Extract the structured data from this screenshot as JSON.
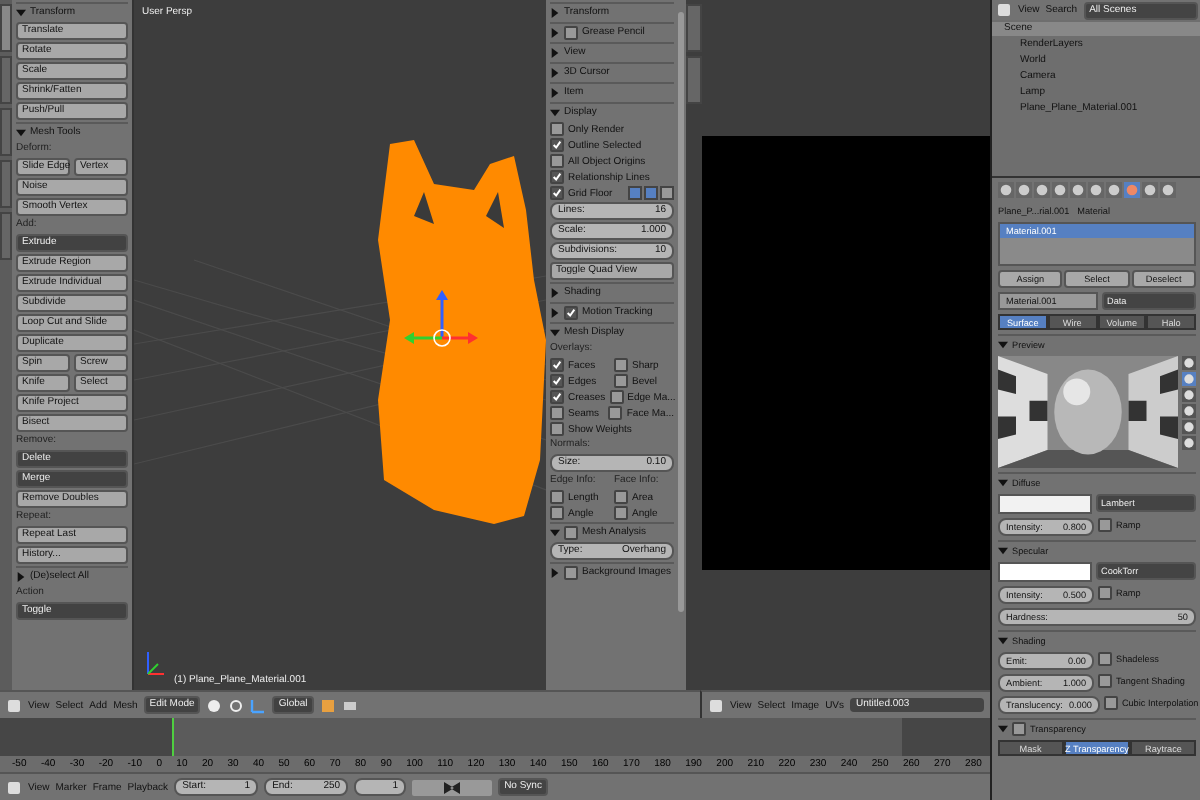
{
  "toolbar": {
    "tabs": [
      {
        "selected": true
      },
      {
        "selected": false
      },
      {
        "selected": false
      },
      {
        "selected": false
      },
      {
        "selected": false
      }
    ],
    "rows": [
      {
        "kind": "header",
        "text": "Transform",
        "expanded": true
      },
      {
        "kind": "button",
        "text": "Translate"
      },
      {
        "kind": "button",
        "text": "Rotate"
      },
      {
        "kind": "button",
        "text": "Scale"
      },
      {
        "kind": "button",
        "text": "Shrink/Fatten"
      },
      {
        "kind": "button",
        "text": "Push/Pull"
      },
      {
        "kind": "header",
        "text": "Mesh Tools",
        "expanded": true
      },
      {
        "kind": "label",
        "text": "Deform:"
      },
      {
        "kind": "pair",
        "texts": [
          "Slide Edge",
          "Vertex"
        ]
      },
      {
        "kind": "button",
        "text": "Noise"
      },
      {
        "kind": "button",
        "text": "Smooth Vertex"
      },
      {
        "kind": "label",
        "text": "Add:"
      },
      {
        "kind": "dropdown",
        "text": "Extrude"
      },
      {
        "kind": "button",
        "text": "Extrude Region"
      },
      {
        "kind": "button",
        "text": "Extrude Individual"
      },
      {
        "kind": "button",
        "text": "Subdivide"
      },
      {
        "kind": "button",
        "text": "Loop Cut and Slide"
      },
      {
        "kind": "button",
        "text": "Duplicate"
      },
      {
        "kind": "pair",
        "texts": [
          "Spin",
          "Screw"
        ]
      },
      {
        "kind": "pair",
        "texts": [
          "Knife",
          "Select"
        ]
      },
      {
        "kind": "button",
        "text": "Knife Project"
      },
      {
        "kind": "button",
        "text": "Bisect"
      },
      {
        "kind": "label",
        "text": "Remove:"
      },
      {
        "kind": "dropdown",
        "text": "Delete"
      },
      {
        "kind": "dropdown",
        "text": "Merge"
      },
      {
        "kind": "button",
        "text": "Remove Doubles"
      },
      {
        "kind": "label",
        "text": "Repeat:"
      },
      {
        "kind": "button",
        "text": "Repeat Last"
      },
      {
        "kind": "button",
        "text": "History..."
      },
      {
        "kind": "header",
        "text": "(De)select All",
        "expanded": false
      },
      {
        "kind": "label",
        "text": "Action"
      },
      {
        "kind": "dropdown",
        "text": "Toggle"
      }
    ]
  },
  "viewport": {
    "title": "User Persp",
    "object_label": "(1) Plane_Plane_Material.001"
  },
  "npanel": {
    "rows": [
      {
        "kind": "header",
        "text": "Transform",
        "expanded": false
      },
      {
        "kind": "header",
        "text": "Grease Pencil",
        "expanded": false,
        "checked": false
      },
      {
        "kind": "header",
        "text": "View",
        "expanded": false
      },
      {
        "kind": "header",
        "text": "3D Cursor",
        "expanded": false
      },
      {
        "kind": "header",
        "text": "Item",
        "expanded": false
      },
      {
        "kind": "header",
        "text": "Display",
        "expanded": true
      },
      {
        "kind": "checkbox",
        "text": "Only Render",
        "checked": false
      },
      {
        "kind": "checkbox",
        "text": "Outline Selected",
        "checked": true
      },
      {
        "kind": "checkbox",
        "text": "All Object Origins",
        "checked": false
      },
      {
        "kind": "checkbox",
        "text": "Relationship Lines",
        "checked": true
      },
      {
        "kind": "checkbox",
        "text": "Grid Floor",
        "checked": true,
        "axes": [
          {
            "selected": true
          },
          {
            "selected": true
          },
          {
            "selected": false
          }
        ]
      },
      {
        "kind": "field",
        "label": "Lines:",
        "value": "16"
      },
      {
        "kind": "field",
        "label": "Scale:",
        "value": "1.000"
      },
      {
        "kind": "field",
        "label": "Subdivisions:",
        "value": "10"
      },
      {
        "kind": "button",
        "text": "Toggle Quad View"
      },
      {
        "kind": "header",
        "text": "Shading",
        "expanded": false
      },
      {
        "kind": "header",
        "text": "Motion Tracking",
        "expanded": false,
        "checked": true
      },
      {
        "kind": "header",
        "text": "Mesh Display",
        "expanded": true
      },
      {
        "kind": "label",
        "text": "Overlays:"
      },
      {
        "kind": "checkpair",
        "items": [
          {
            "text": "Faces",
            "checked": true
          },
          {
            "text": "Sharp",
            "checked": false
          }
        ]
      },
      {
        "kind": "checkpair",
        "items": [
          {
            "text": "Edges",
            "checked": true
          },
          {
            "text": "Bevel",
            "checked": false
          }
        ]
      },
      {
        "kind": "checkpair",
        "items": [
          {
            "text": "Creases",
            "checked": true
          },
          {
            "text": "Edge Ma...",
            "checked": false
          }
        ]
      },
      {
        "kind": "checkpair",
        "items": [
          {
            "text": "Seams",
            "checked": false
          },
          {
            "text": "Face Ma...",
            "checked": false
          }
        ]
      },
      {
        "kind": "checkbox",
        "text": "Show Weights",
        "checked": false
      },
      {
        "kind": "label",
        "text": "Normals:"
      },
      {
        "kind": "field",
        "label": "Size:",
        "value": "0.10"
      },
      {
        "kind": "labelpair",
        "texts": [
          "Edge Info:",
          "Face Info:"
        ]
      },
      {
        "kind": "checkpair",
        "items": [
          {
            "text": "Length",
            "checked": false
          },
          {
            "text": "Area",
            "checked": false
          }
        ]
      },
      {
        "kind": "checkpair",
        "items": [
          {
            "text": "Angle",
            "checked": false
          },
          {
            "text": "Angle",
            "checked": false
          }
        ]
      },
      {
        "kind": "header",
        "text": "Mesh Analysis",
        "expanded": true,
        "checked": false
      },
      {
        "kind": "field",
        "label": "Type:",
        "value": "Overhang"
      },
      {
        "kind": "header",
        "text": "Background Images",
        "expanded": false,
        "checked": false
      }
    ]
  },
  "outliner": {
    "menus": [
      "View",
      "Search"
    ],
    "scope": "All Scenes",
    "tree": [
      {
        "text": "Scene",
        "children": [
          {
            "text": "RenderLayers"
          },
          {
            "text": "World"
          },
          {
            "text": "Camera"
          },
          {
            "text": "Lamp"
          },
          {
            "text": "Plane_Plane_Material.001"
          }
        ]
      }
    ]
  },
  "properties": {
    "path": [
      "Plane_P...rial.001",
      "Material"
    ],
    "slot": "Material.001",
    "slot_buttons": [
      "Assign",
      "Select",
      "Deselect"
    ],
    "material": "Material.001",
    "link": "Data",
    "tabs": [
      {
        "text": "Surface",
        "selected": true
      },
      {
        "text": "Wire",
        "selected": false
      },
      {
        "text": "Volume",
        "selected": false
      },
      {
        "text": "Halo",
        "selected": false
      }
    ],
    "rows": [
      {
        "kind": "header",
        "text": "Preview",
        "expanded": true
      },
      {
        "kind": "preview"
      },
      {
        "kind": "header",
        "text": "Diffuse",
        "expanded": true
      },
      {
        "kind": "swatch",
        "color": "#f2f2f2",
        "text": "Lambert"
      },
      {
        "kind": "fieldcheck",
        "label": "Intensity:",
        "value": "0.800",
        "text": "Ramp",
        "checked": false
      },
      {
        "kind": "header",
        "text": "Specular",
        "expanded": true
      },
      {
        "kind": "swatch",
        "color": "#ffffff",
        "text": "CookTorr"
      },
      {
        "kind": "fieldcheck",
        "label": "Intensity:",
        "value": "0.500",
        "text": "Ramp",
        "checked": false
      },
      {
        "kind": "field",
        "label": "Hardness:",
        "value": "50"
      },
      {
        "kind": "header",
        "text": "Shading",
        "expanded": true
      },
      {
        "kind": "fieldcheck",
        "label": "Emit:",
        "value": "0.00",
        "text": "Shadeless",
        "checked": false
      },
      {
        "kind": "fieldcheck",
        "label": "Ambient:",
        "value": "1.000",
        "text": "Tangent Shading",
        "checked": false
      },
      {
        "kind": "fieldcheck",
        "label": "Translucency:",
        "value": "0.000",
        "text": "Cubic Interpolation",
        "checked": false
      },
      {
        "kind": "header",
        "text": "Transparency",
        "expanded": true,
        "checked": false
      },
      {
        "kind": "tabs",
        "items": [
          {
            "text": "Mask",
            "selected": false
          },
          {
            "text": "Z Transparency",
            "selected": true
          },
          {
            "text": "Raytrace",
            "selected": false
          }
        ]
      }
    ]
  },
  "view_header": {
    "menus": [
      "View",
      "Select",
      "Add",
      "Mesh"
    ],
    "mode": "Edit Mode",
    "orientation": "Global"
  },
  "image_header": {
    "menus": [
      "View",
      "Select",
      "Image",
      "UVs"
    ],
    "image": "Untitled.003"
  },
  "timeline": {
    "ruler": [
      "-50",
      "-40",
      "-30",
      "-20",
      "-10",
      "0",
      "10",
      "20",
      "30",
      "40",
      "50",
      "60",
      "70",
      "80",
      "90",
      "100",
      "110",
      "120",
      "130",
      "140",
      "150",
      "160",
      "170",
      "180",
      "190",
      "200",
      "210",
      "220",
      "230",
      "240",
      "250",
      "260",
      "270",
      "280"
    ],
    "menus": [
      "View",
      "Marker",
      "Frame",
      "Playback"
    ],
    "start": {
      "label": "Start:",
      "value": "1"
    },
    "end": {
      "label": "End:",
      "value": "250"
    },
    "current": "1",
    "sync": "No Sync"
  }
}
